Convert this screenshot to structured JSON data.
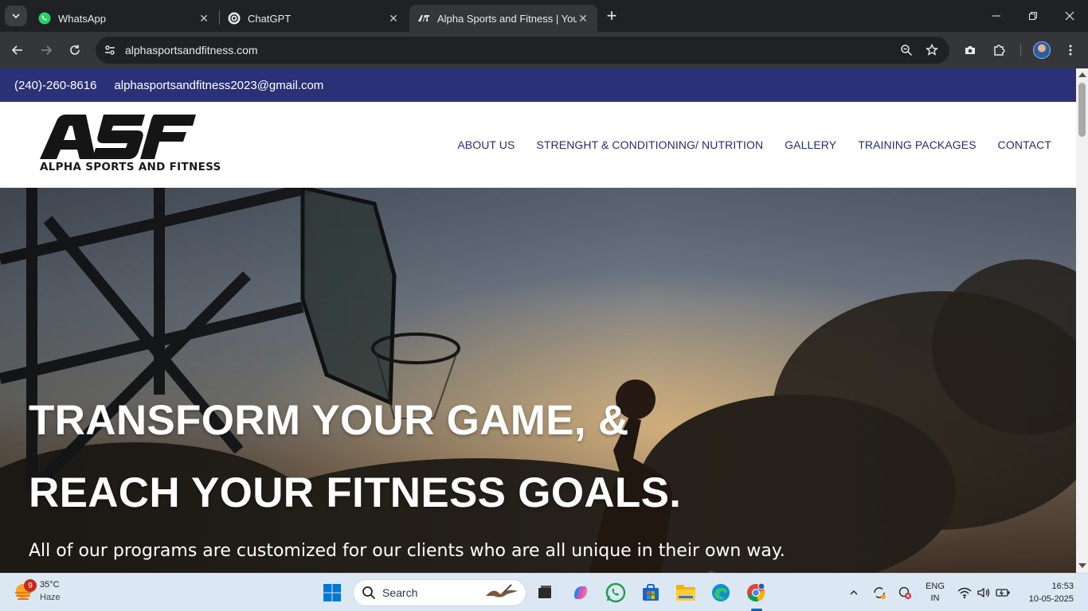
{
  "browser": {
    "tabs": [
      {
        "title": "WhatsApp",
        "icon": "whatsapp-icon",
        "active": false
      },
      {
        "title": "ChatGPT",
        "icon": "chatgpt-icon",
        "active": false
      },
      {
        "title": "Alpha Sports and Fitness | Your",
        "icon": "asf-icon",
        "active": true
      }
    ],
    "url": "alphasportsandfitness.com"
  },
  "site": {
    "phone": "(240)-260-8616",
    "email": "alphasportsandfitness2023@gmail.com",
    "logo_mark": "ASF",
    "logo_text": "ALPHA SPORTS AND FITNESS",
    "menu": [
      {
        "label": "ABOUT US"
      },
      {
        "label": "STRENGHT & CONDITIONING/ NUTRITION"
      },
      {
        "label": "GALLERY"
      },
      {
        "label": "TRAINING PACKAGES"
      },
      {
        "label": "CONTACT"
      }
    ],
    "hero": {
      "line1": "TRANSFORM YOUR GAME, &",
      "line2": "REACH YOUR FITNESS GOALS.",
      "subtitle": "All of our programs are customized for our clients who are all unique in their own way."
    },
    "colors": {
      "topbar": "#2a3176",
      "menu": "#262e6b"
    }
  },
  "taskbar": {
    "weather": {
      "temp": "35°C",
      "condition": "Haze",
      "badge": "9"
    },
    "search_label": "Search",
    "tray": {
      "lang1": "ENG",
      "lang2": "IN"
    },
    "clock": {
      "time": "16:53",
      "date": "10-05-2025"
    }
  }
}
